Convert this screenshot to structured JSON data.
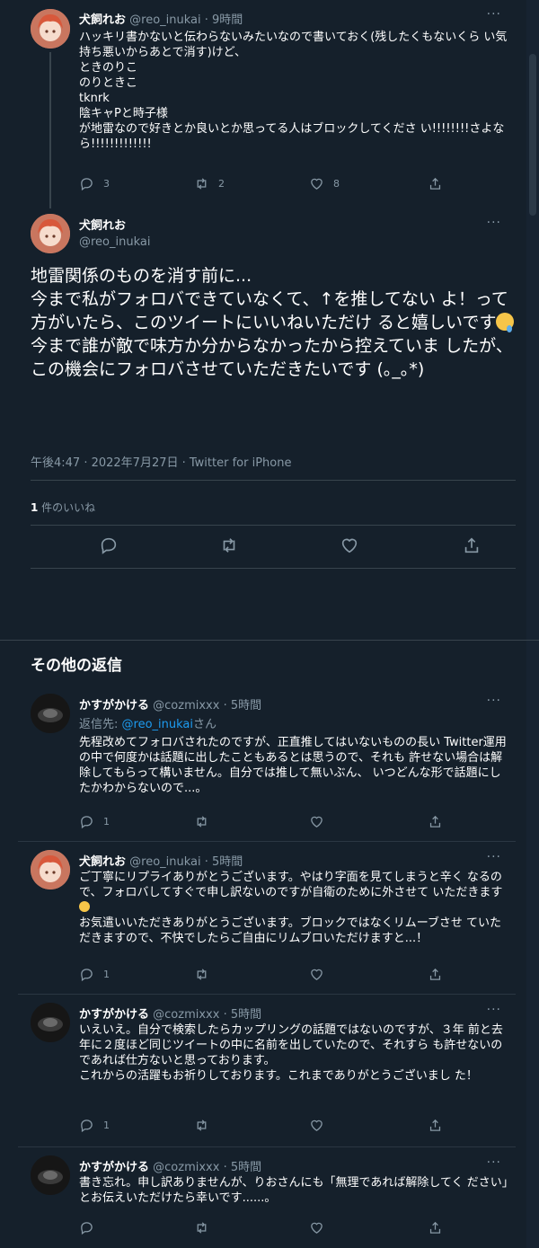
{
  "colors": {
    "background": "#15202b",
    "text": "#ffffff",
    "muted": "#8899a6",
    "link": "#1d9bf0",
    "divider": "#38444d"
  },
  "icons": {
    "reply": "reply-icon",
    "retweet": "retweet-icon",
    "like": "heart-icon",
    "share": "share-icon",
    "more": "more-icon"
  },
  "tweet1": {
    "name": "犬飼れお",
    "meta": "@reo_inukai · 9時間",
    "text": "ハッキリ書かないと伝わらないみたいなので書いておく(残したくもないくら い気持ち悪いからあとで消す)けど、\nときのりこ\nのりときこ\ntknrk\n陰キャPと時子様\nが地雷なので好きとか良いとか思ってる人はブロックしてくださ い!!!!!!!!さよなら!!!!!!!!!!!!!",
    "reply_count": "3",
    "retweet_count": "2",
    "like_count": "8"
  },
  "main": {
    "name": "犬飼れお",
    "handle": "@reo_inukai",
    "text_before_emoji": "地雷関係のものを消す前に...\n今まで私がフォロバできていなくて、↑を推してない よ！って方がいたら、このツイートにいいねいただけ ると嬉しいです",
    "text_after_emoji": "\n今まで誰が敵で味方か分からなかったから控えていま したが、この機会にフォロバさせていただきたいです (｡_｡*)",
    "timestamp": "午後4:47 · 2022年7月27日 · Twitter for iPhone",
    "likes_count": "1",
    "likes_label": " 件のいいね"
  },
  "section_title": "その他の返信",
  "replies": [
    {
      "name": "かすがかける",
      "meta": "@cozmixxx · 5時間",
      "reply_prefix": "返信先: ",
      "reply_mention": "@reo_inukai",
      "reply_suffix": "さん",
      "text": "先程改めてフォロバされたのですが、正直推してはいないものの長い Twitter運用の中で何度かは話題に出したこともあるとは思うので、それも 許せない場合は解除してもらって構いません。自分では推して無いぶん、 いつどんな形で話題にしたかわからないので...。",
      "reply_count": "1"
    },
    {
      "name": "犬飼れお",
      "meta": "@reo_inukai · 5時間",
      "text_before_emoji": "ご丁寧にリプライありがとうございます。やはり字面を見てしまうと辛く なるので、フォロバしてすぐで申し訳ないのですが自衛のために外させて いただきます",
      "text_after_emoji": "\nお気遣いいただきありがとうございます。ブロックではなくリムーブさせ ていただきますので、不快でしたらご自由にリムブロいただけますと...！",
      "reply_count": "1"
    },
    {
      "name": "かすがかける",
      "meta": "@cozmixxx · 5時間",
      "text": "いえいえ。自分で検索したらカップリングの話題ではないのですが、３年 前と去年に２度ほど同じツイートの中に名前を出していたので、それすら も許せないのであれば仕方ないと思っております。\nこれからの活躍もお祈りしております。これまでありがとうございまし た！",
      "reply_count": "1"
    },
    {
      "name": "かすがかける",
      "meta": "@cozmixxx · 5時間",
      "text": "書き忘れ。申し訳ありませんが、りおさんにも「無理であれば解除してく ださい」とお伝えいただけたら幸いです......。",
      "reply_count": ""
    }
  ]
}
